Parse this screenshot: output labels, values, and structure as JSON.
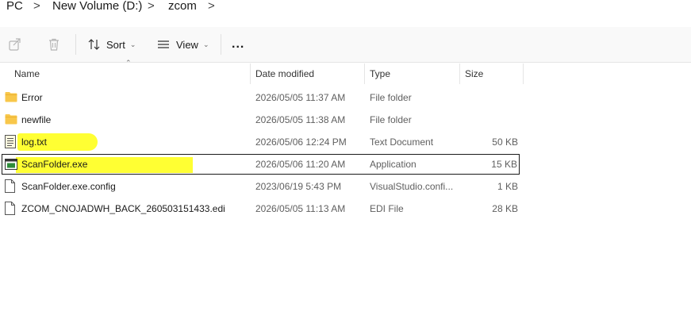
{
  "breadcrumb": {
    "items": [
      "PC",
      "New Volume (D:)",
      "zcom"
    ],
    "separator": ">"
  },
  "toolbar": {
    "share_icon": "share-icon",
    "delete_icon": "trash-icon",
    "sort_label": "Sort",
    "view_label": "View",
    "more_label": "..."
  },
  "columns": {
    "name": "Name",
    "date": "Date modified",
    "type": "Type",
    "size": "Size"
  },
  "files": [
    {
      "name": "Error",
      "date": "2026/05/05 11:37 AM",
      "type": "File folder",
      "size": "",
      "icon": "folder-icon"
    },
    {
      "name": "newfile",
      "date": "2026/05/05 11:38 AM",
      "type": "File folder",
      "size": "",
      "icon": "folder-icon"
    },
    {
      "name": "log.txt",
      "date": "2026/05/06 12:24 PM",
      "type": "Text Document",
      "size": "50 KB",
      "icon": "text-file-icon"
    },
    {
      "name": "ScanFolder.exe",
      "date": "2026/05/06 11:20 AM",
      "type": "Application",
      "size": "15 KB",
      "icon": "exe-icon"
    },
    {
      "name": "ScanFolder.exe.config",
      "date": "2023/06/19 5:43 PM",
      "type": "VisualStudio.confi...",
      "size": "1 KB",
      "icon": "file-icon"
    },
    {
      "name": "ZCOM_CNOJADWH_BACK_260503151433.edi",
      "date": "2026/05/05 11:13 AM",
      "type": "EDI File",
      "size": "28 KB",
      "icon": "file-icon"
    }
  ],
  "colors": {
    "highlight": "#ffff33",
    "folder": "#f8c74a",
    "selection_border": "#1a1a1a"
  }
}
